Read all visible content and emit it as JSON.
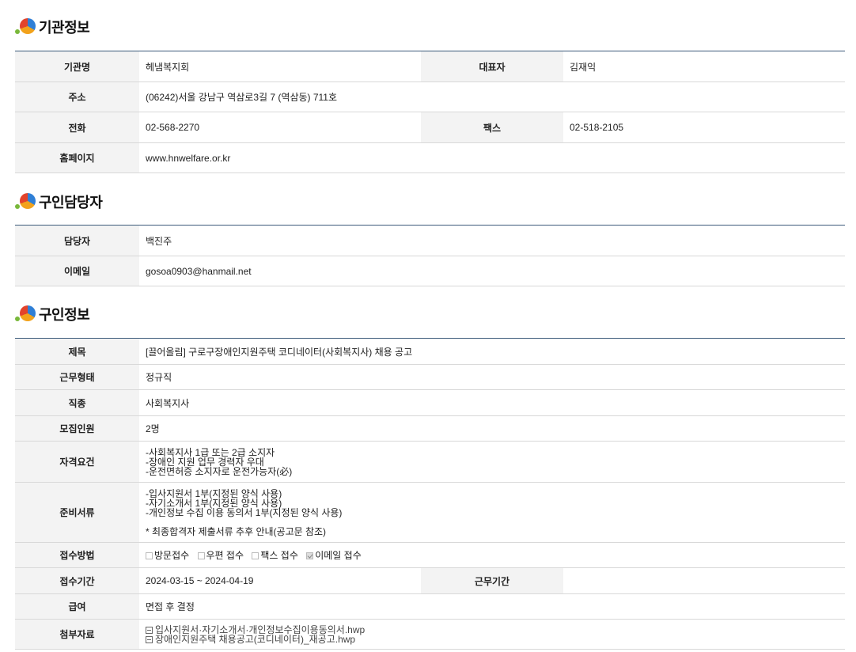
{
  "org_section": {
    "title": "기관정보",
    "rows": {
      "name_label": "기관명",
      "name_value": "헤냄복지회",
      "rep_label": "대표자",
      "rep_value": "김재익",
      "addr_label": "주소",
      "addr_value": "(06242)서울 강남구 역삼로3길 7 (역삼동) 711호",
      "tel_label": "전화",
      "tel_value": "02-568-2270",
      "fax_label": "팩스",
      "fax_value": "02-518-2105",
      "web_label": "홈페이지",
      "web_value": "www.hnwelfare.or.kr"
    }
  },
  "contact_section": {
    "title": "구인담당자",
    "person_label": "담당자",
    "person_value": "백진주",
    "email_label": "이메일",
    "email_value": "gosoa0903@hanmail.net"
  },
  "job_section": {
    "title": "구인정보",
    "subject_label": "제목",
    "subject_value": "[끌어올림] 구로구장애인지원주택 코디네이터(사회복지사) 채용 공고",
    "type_label": "근무형태",
    "type_value": "정규직",
    "category_label": "직종",
    "category_value": "사회복지사",
    "count_label": "모집인원",
    "count_value": "2명",
    "qual_label": "자격요건",
    "qual_lines": [
      "-사회복지사 1급 또는 2급 소지자",
      "-장애인 지원 업무 경력자 우대",
      "-운전면허증 소지자로 운전가능자(必)"
    ],
    "docs_label": "준비서류",
    "docs_lines": [
      "-입사지원서 1부(지정된 양식 사용)",
      "-자기소개서 1부(지정된 양식 사용)",
      "-개인정보 수집 이용 동의서 1부(지정된 양식 사용)"
    ],
    "docs_note": "* 최종합격자 제출서류 추후 안내(공고문 참조)",
    "method_label": "접수방법",
    "methods": [
      {
        "label": "방문접수",
        "checked": false
      },
      {
        "label": "우편 접수",
        "checked": false
      },
      {
        "label": "팩스 접수",
        "checked": false
      },
      {
        "label": "이메일 접수",
        "checked": true
      }
    ],
    "period_label": "접수기간",
    "period_value": "2024-03-15 ~ 2024-04-19",
    "work_period_label": "근무기간",
    "work_period_value": "",
    "salary_label": "급여",
    "salary_value": "면접 후 결정",
    "attach_label": "첨부자료",
    "attachments": [
      "입사지원서·자기소개서·개인정보수집이용동의서.hwp",
      "장애인지원주택 채용공고(코디네이터)_재공고.hwp"
    ]
  }
}
